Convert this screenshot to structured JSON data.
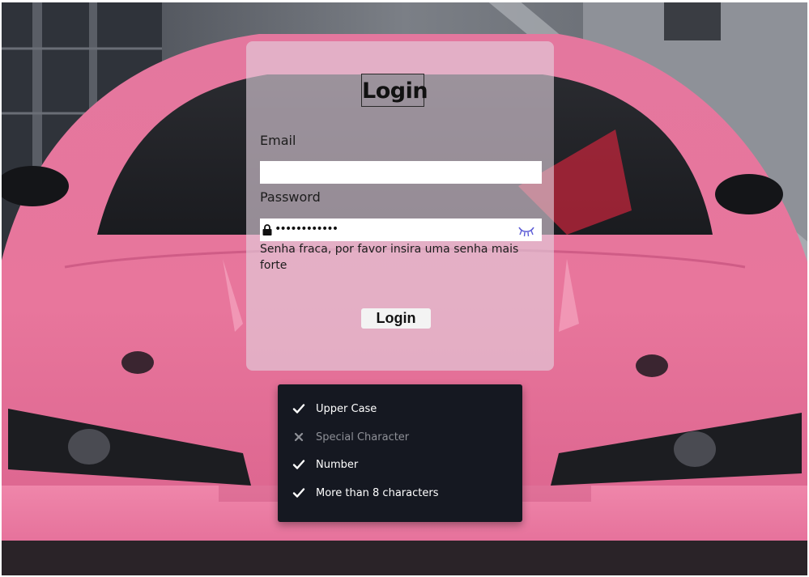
{
  "login": {
    "title": "Login",
    "email_label": "Email",
    "email_value": "",
    "password_label": "Password",
    "password_value": "••••••••••••",
    "password_warning": "Senha fraca, por favor insira uma senha mais forte",
    "submit_label": "Login"
  },
  "requirements": [
    {
      "label": "Upper Case",
      "met": true
    },
    {
      "label": "Special Character",
      "met": false
    },
    {
      "label": "Number",
      "met": true
    },
    {
      "label": "More than 8 characters",
      "met": true
    }
  ],
  "icons": {
    "lock": "lock-icon",
    "eye": "closed-eye-icon",
    "check": "check-icon",
    "cross": "x-icon"
  },
  "colors": {
    "car_pink": "#e8749a",
    "card_overlay": "#e2d2de",
    "checklist_bg": "#151821",
    "met_text": "#ffffff",
    "unmet_text": "#8e9097",
    "eye_icon": "#5b5bd6"
  }
}
